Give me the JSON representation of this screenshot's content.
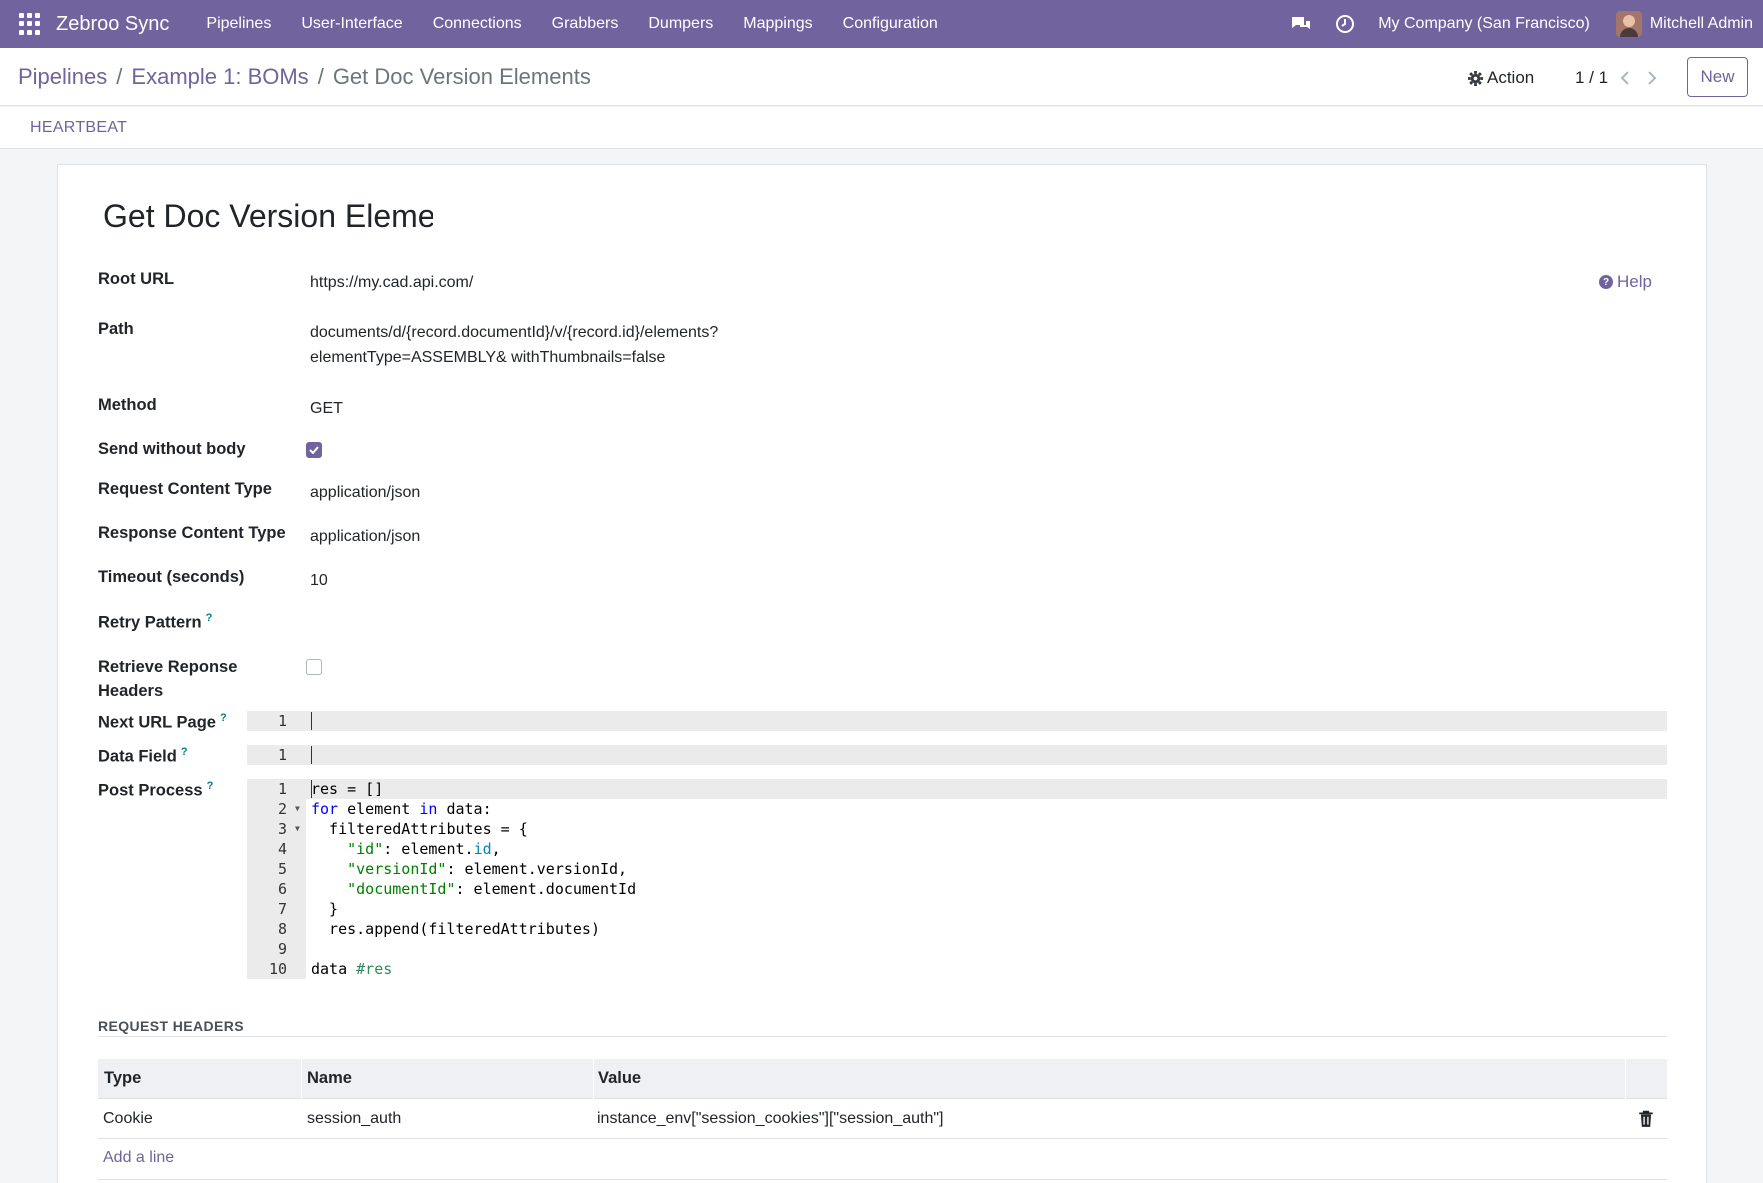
{
  "app": {
    "brand": "Zebroo Sync",
    "menu": [
      "Pipelines",
      "User-Interface",
      "Connections",
      "Grabbers",
      "Dumpers",
      "Mappings",
      "Configuration"
    ],
    "company": "My Company (San Francisco)",
    "user": "Mitchell Admin"
  },
  "breadcrumb": {
    "items": [
      "Pipelines",
      "Example 1: BOMs"
    ],
    "separator": "/",
    "current": "Get Doc Version Elements"
  },
  "control": {
    "action_label": "Action",
    "pager": "1 / 1",
    "new_label": "New"
  },
  "statusbar": {
    "heartbeat_label": "HEARTBEAT"
  },
  "form": {
    "title": "Get Doc Version Elements",
    "help_label": "Help",
    "fields": {
      "root_url": {
        "label": "Root URL",
        "value": "https://my.cad.api.com/"
      },
      "path": {
        "label": "Path",
        "line1": "documents/d/{record.documentId}/v/{record.id}/elements?",
        "line2": "elementType=ASSEMBLY& withThumbnails=false"
      },
      "method": {
        "label": "Method",
        "value": "GET"
      },
      "send_without_body": {
        "label": "Send without body",
        "checked": true
      },
      "request_content_type": {
        "label": "Request Content Type",
        "value": "application/json"
      },
      "response_content_type": {
        "label": "Response Content Type",
        "value": "application/json"
      },
      "timeout": {
        "label": "Timeout (seconds)",
        "value": "10"
      },
      "retry_pattern": {
        "label": "Retry Pattern",
        "tooltip": "?"
      },
      "retrieve_headers": {
        "label": "Retrieve Reponse Headers",
        "checked": false
      },
      "next_url_page": {
        "label": "Next URL Page",
        "tooltip": "?",
        "line_number": "1"
      },
      "data_field": {
        "label": "Data Field",
        "tooltip": "?",
        "line_number": "1"
      },
      "post_process": {
        "label": "Post Process",
        "tooltip": "?",
        "line_numbers": [
          "1",
          "2",
          "3",
          "4",
          "5",
          "6",
          "7",
          "8",
          "9",
          "10"
        ],
        "lines": [
          "res = []",
          "for element in data:",
          "  filteredAttributes = {",
          "    \"id\": element.id,",
          "    \"versionId\": element.versionId,",
          "    \"documentId\": element.documentId",
          "  }",
          "  res.append(filteredAttributes)",
          "",
          "data #res"
        ]
      }
    }
  },
  "request_headers": {
    "title": "REQUEST HEADERS",
    "columns": [
      "Type",
      "Name",
      "Value"
    ],
    "rows": [
      {
        "type": "Cookie",
        "name": "session_auth",
        "value": "instance_env[\"session_cookies\"][\"session_auth\"]"
      }
    ],
    "add_line_label": "Add a line"
  },
  "colors": {
    "brand": "#71639e",
    "tooltip": "#017e84",
    "keyword": "#0000ff",
    "string": "#008000"
  },
  "icons": [
    "apps-grid-icon",
    "chat-icon",
    "clock-icon",
    "gear-icon",
    "chevron-left-icon",
    "chevron-right-icon",
    "help-icon",
    "check-icon",
    "trash-icon"
  ]
}
